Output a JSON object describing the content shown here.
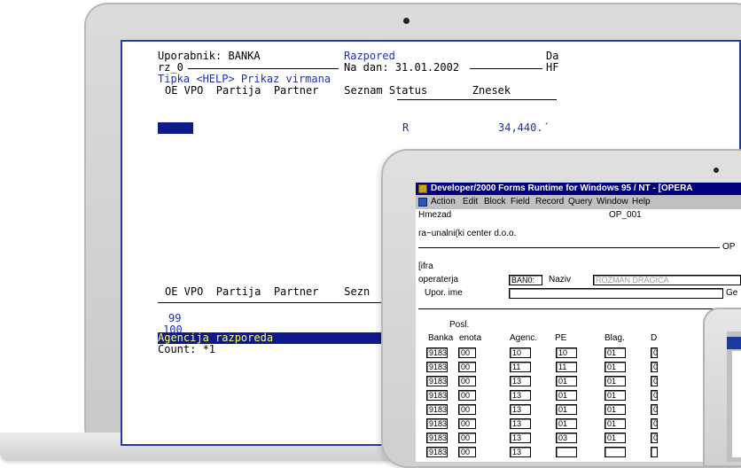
{
  "terminal": {
    "user_label": "Uporabnik: BANKA",
    "module_title": "Razpored",
    "date_right_label": "Da",
    "row2_left": "rz_0",
    "date_line": "Na dan: 31.01.2002",
    "row2_right": "HF",
    "help_hint": "Tipka <HELP> Prikaz virmana",
    "header_top": "OE VPO  Partija  Partner    Seznam Status       Znesek",
    "first_row": {
      "status": "R",
      "amount": "34,440.´"
    },
    "header_bottom": "OE VPO  Partija  Partner    Sezn",
    "rows": [
      "99",
      "100"
    ],
    "status_bar": "Agencija razporeda",
    "count": "Count: *1"
  },
  "forms_app": {
    "title": "Developer/2000 Forms Runtime for Windows 95 / NT - [OPERA",
    "menu": [
      "Action",
      "Edit",
      "Block",
      "Field",
      "Record",
      "Query",
      "Window",
      "Help"
    ],
    "label_hmezad": "Hmezad",
    "form_code": "OP_001",
    "company": "ra~unalni(ki center d.o.o.",
    "section_code": "OP",
    "label_sifra": "[ifra",
    "label_operaterja": "operaterja",
    "operator_code": "BAN0:",
    "label_naziv": "Naziv",
    "operator_name": "ROZMAN DRAGICA",
    "label_upor_ime": "Upor. ime",
    "label_ge": "Ge",
    "col_posl": "Posl.",
    "columns": [
      "Banka",
      "enota",
      "Agenc.",
      "PE",
      "Blag.",
      "D"
    ],
    "rows": [
      {
        "banka": "9183",
        "enota": "00",
        "agenc": "10",
        "pe": "10",
        "blag": "01",
        "d": "0"
      },
      {
        "banka": "9183",
        "enota": "00",
        "agenc": "11",
        "pe": "11",
        "blag": "01",
        "d": "0"
      },
      {
        "banka": "9183",
        "enota": "00",
        "agenc": "13",
        "pe": "01",
        "blag": "01",
        "d": "0"
      },
      {
        "banka": "9183",
        "enota": "00",
        "agenc": "13",
        "pe": "01",
        "blag": "01",
        "d": "0"
      },
      {
        "banka": "9183",
        "enota": "00",
        "agenc": "13",
        "pe": "01",
        "blag": "01",
        "d": "0"
      },
      {
        "banka": "9183",
        "enota": "00",
        "agenc": "13",
        "pe": "01",
        "blag": "01",
        "d": "0"
      },
      {
        "banka": "9183",
        "enota": "00",
        "agenc": "13",
        "pe": "03",
        "blag": "01",
        "d": "0"
      },
      {
        "banka": "9183",
        "enota": "00",
        "agenc": "13",
        "pe": "",
        "blag": "",
        "d": ""
      }
    ]
  },
  "colors": {
    "terminal_blue": "#1e2fb4",
    "selection_navy": "#0e1a8c",
    "status_text_yellow": "#ffff66",
    "win_title_navy": "#000080",
    "win_gray": "#c0c0c0"
  },
  "icons": [
    "laptop-camera",
    "app-icon",
    "form-icon"
  ]
}
